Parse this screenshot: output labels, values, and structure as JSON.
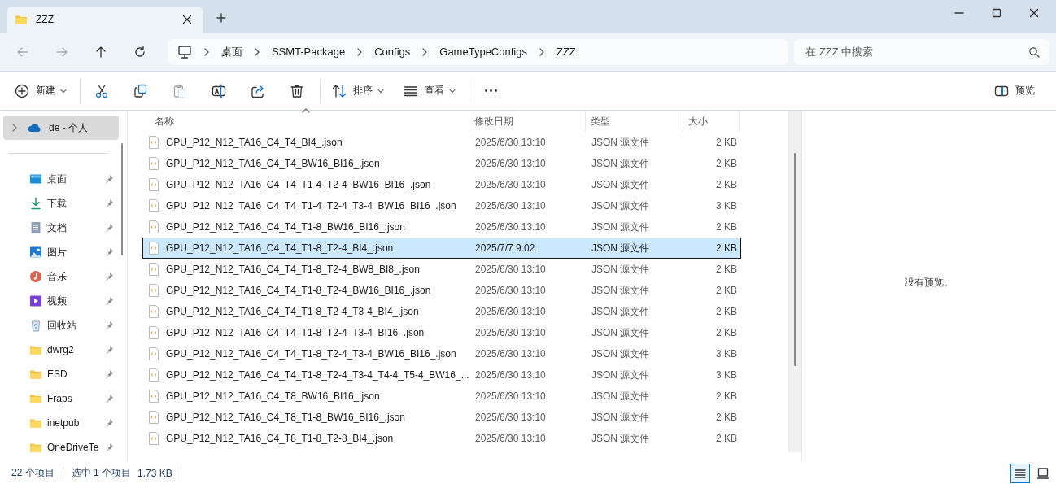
{
  "window": {
    "tab_title": "ZZZ"
  },
  "navigation": {
    "back_disabled": true,
    "forward_disabled": true,
    "breadcrumbs": [
      "桌面",
      "SSMT-Package",
      "Configs",
      "GameTypeConfigs",
      "ZZZ"
    ],
    "search": {
      "placeholder": "在 ZZZ 中搜索"
    }
  },
  "toolbar": [
    {
      "kind": "menu",
      "label": "新建",
      "disabled": false
    },
    {
      "kind": "icon",
      "disabled": false
    },
    {
      "kind": "icon",
      "disabled": false
    },
    {
      "kind": "icon",
      "disabled": true
    },
    {
      "kind": "icon",
      "disabled": false
    },
    {
      "kind": "icon",
      "disabled": false
    },
    {
      "kind": "icon",
      "disabled": false
    },
    {
      "kind": "menu",
      "label": "排序",
      "disabled": false
    },
    {
      "kind": "menu",
      "label": "查看",
      "disabled": false
    },
    {
      "kind": "icon",
      "disabled": false
    }
  ],
  "preview_button": {
    "label": "预览"
  },
  "sidebar": {
    "account": {
      "label": "de - 个人",
      "selected": true
    },
    "items": [
      {
        "label": "桌面",
        "pinned": true
      },
      {
        "label": "下载",
        "pinned": true
      },
      {
        "label": "文档",
        "pinned": true
      },
      {
        "label": "图片",
        "pinned": true
      },
      {
        "label": "音乐",
        "pinned": true
      },
      {
        "label": "视频",
        "pinned": true
      },
      {
        "label": "回收站",
        "pinned": true
      },
      {
        "label": "dwrg2",
        "pinned": true
      },
      {
        "label": "ESD",
        "pinned": true
      },
      {
        "label": "Fraps",
        "pinned": true
      },
      {
        "label": "inetpub",
        "pinned": true
      },
      {
        "label": "OneDriveTe",
        "pinned": true
      }
    ]
  },
  "table": {
    "columns": [
      {
        "label": "名称",
        "sorted": true
      },
      {
        "label": "修改日期",
        "sorted": false
      },
      {
        "label": "类型",
        "sorted": false
      },
      {
        "label": "大小",
        "sorted": false
      }
    ],
    "rows": [
      {
        "name": "GPU_P12_N12_TA16_C4_T4_BI4_.json",
        "modified": "2025/6/30 13:10",
        "type": "JSON 源文件",
        "size": "2 KB",
        "selected": false
      },
      {
        "name": "GPU_P12_N12_TA16_C4_T4_BW16_BI16_.json",
        "modified": "2025/6/30 13:10",
        "type": "JSON 源文件",
        "size": "2 KB",
        "selected": false
      },
      {
        "name": "GPU_P12_N12_TA16_C4_T4_T1-4_T2-4_BW16_BI16_.json",
        "modified": "2025/6/30 13:10",
        "type": "JSON 源文件",
        "size": "2 KB",
        "selected": false
      },
      {
        "name": "GPU_P12_N12_TA16_C4_T4_T1-4_T2-4_T3-4_BW16_BI16_.json",
        "modified": "2025/6/30 13:10",
        "type": "JSON 源文件",
        "size": "3 KB",
        "selected": false
      },
      {
        "name": "GPU_P12_N12_TA16_C4_T4_T1-8_BW16_BI16_.json",
        "modified": "2025/6/30 13:10",
        "type": "JSON 源文件",
        "size": "2 KB",
        "selected": false
      },
      {
        "name": "GPU_P12_N12_TA16_C4_T4_T1-8_T2-4_BI4_.json",
        "modified": "2025/7/7 9:02",
        "type": "JSON 源文件",
        "size": "2 KB",
        "selected": true
      },
      {
        "name": "GPU_P12_N12_TA16_C4_T4_T1-8_T2-4_BW8_BI8_.json",
        "modified": "2025/6/30 13:10",
        "type": "JSON 源文件",
        "size": "2 KB",
        "selected": false
      },
      {
        "name": "GPU_P12_N12_TA16_C4_T4_T1-8_T2-4_BW16_BI16_.json",
        "modified": "2025/6/30 13:10",
        "type": "JSON 源文件",
        "size": "2 KB",
        "selected": false
      },
      {
        "name": "GPU_P12_N12_TA16_C4_T4_T1-8_T2-4_T3-4_BI4_.json",
        "modified": "2025/6/30 13:10",
        "type": "JSON 源文件",
        "size": "2 KB",
        "selected": false
      },
      {
        "name": "GPU_P12_N12_TA16_C4_T4_T1-8_T2-4_T3-4_BI16_.json",
        "modified": "2025/6/30 13:10",
        "type": "JSON 源文件",
        "size": "2 KB",
        "selected": false
      },
      {
        "name": "GPU_P12_N12_TA16_C4_T4_T1-8_T2-4_T3-4_BW16_BI16_.json",
        "modified": "2025/6/30 13:10",
        "type": "JSON 源文件",
        "size": "3 KB",
        "selected": false
      },
      {
        "name": "GPU_P12_N12_TA16_C4_T4_T1-8_T2-4_T3-4_T4-4_T5-4_BW16_...",
        "modified": "2025/6/30 13:10",
        "type": "JSON 源文件",
        "size": "3 KB",
        "selected": false
      },
      {
        "name": "GPU_P12_N12_TA16_C4_T8_BW16_BI16_.json",
        "modified": "2025/6/30 13:10",
        "type": "JSON 源文件",
        "size": "2 KB",
        "selected": false
      },
      {
        "name": "GPU_P12_N12_TA16_C4_T8_T1-8_BW16_BI16_.json",
        "modified": "2025/6/30 13:10",
        "type": "JSON 源文件",
        "size": "2 KB",
        "selected": false
      },
      {
        "name": "GPU_P12_N12_TA16_C4_T8_T1-8_T2-8_BI4_.json",
        "modified": "2025/6/30 13:10",
        "type": "JSON 源文件",
        "size": "2 KB",
        "selected": false
      }
    ]
  },
  "preview": {
    "message": "没有预览。"
  },
  "status_bar": {
    "item_count": "22 个项目",
    "selection": "选中 1 个项目",
    "selection_size": "1.73 KB",
    "view_modes": [
      {
        "kind": "details",
        "selected": true
      },
      {
        "kind": "tiles",
        "selected": false
      }
    ]
  }
}
